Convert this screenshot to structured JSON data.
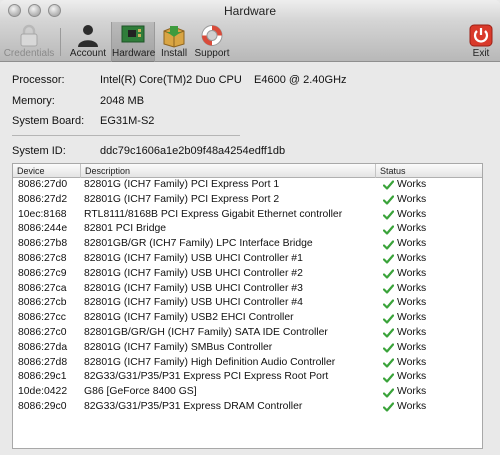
{
  "window": {
    "title": "Hardware"
  },
  "toolbar": {
    "items": [
      {
        "label": "Credentials",
        "icon": "padlock-icon"
      },
      {
        "label": "Account",
        "icon": "user-silhouette-icon"
      },
      {
        "label": "Hardware",
        "icon": "circuit-board-icon"
      },
      {
        "label": "Install",
        "icon": "package-box-icon"
      },
      {
        "label": "Support",
        "icon": "lifebuoy-icon"
      },
      {
        "label": "Exit",
        "icon": "power-icon"
      }
    ]
  },
  "system": {
    "processor_label": "Processor:",
    "processor_value": "Intel(R) Core(TM)2 Duo CPU    E4600 @ 2.40GHz",
    "memory_label": "Memory:",
    "memory_value": "2048 MB",
    "board_label": "System Board:",
    "board_value": "EG31M-S2",
    "id_label": "System ID:",
    "id_value": "ddc79c1606a1e2b09f48a4254edff1db"
  },
  "table": {
    "headers": [
      "Device",
      "Description",
      "Status"
    ],
    "rows": [
      {
        "device": "8086:27d0",
        "description": "82801G (ICH7 Family) PCI Express Port 1",
        "status": "Works"
      },
      {
        "device": "8086:27d2",
        "description": "82801G (ICH7 Family) PCI Express Port 2",
        "status": "Works"
      },
      {
        "device": "10ec:8168",
        "description": "RTL8111/8168B PCI Express Gigabit Ethernet controller",
        "status": "Works"
      },
      {
        "device": "8086:244e",
        "description": "82801 PCI Bridge",
        "status": "Works"
      },
      {
        "device": "8086:27b8",
        "description": "82801GB/GR (ICH7 Family) LPC Interface Bridge",
        "status": "Works"
      },
      {
        "device": "8086:27c8",
        "description": "82801G (ICH7 Family) USB UHCI Controller #1",
        "status": "Works"
      },
      {
        "device": "8086:27c9",
        "description": "82801G (ICH7 Family) USB UHCI Controller #2",
        "status": "Works"
      },
      {
        "device": "8086:27ca",
        "description": "82801G (ICH7 Family) USB UHCI Controller #3",
        "status": "Works"
      },
      {
        "device": "8086:27cb",
        "description": "82801G (ICH7 Family) USB UHCI Controller #4",
        "status": "Works"
      },
      {
        "device": "8086:27cc",
        "description": "82801G (ICH7 Family) USB2 EHCI Controller",
        "status": "Works"
      },
      {
        "device": "8086:27c0",
        "description": "82801GB/GR/GH (ICH7 Family) SATA IDE Controller",
        "status": "Works"
      },
      {
        "device": "8086:27da",
        "description": "82801G (ICH7 Family) SMBus Controller",
        "status": "Works"
      },
      {
        "device": "8086:27d8",
        "description": "82801G (ICH7 Family) High Definition Audio Controller",
        "status": "Works"
      },
      {
        "device": "8086:29c1",
        "description": "82G33/G31/P35/P31 Express PCI Express Root Port",
        "status": "Works"
      },
      {
        "device": "10de:0422",
        "description": "G86 [GeForce 8400 GS]",
        "status": "Works"
      },
      {
        "device": "8086:29c0",
        "description": "82G33/G31/P35/P31 Express DRAM Controller",
        "status": "Works"
      }
    ]
  },
  "colors": {
    "works_check": "#3aa33a",
    "exit_red": "#d93a2b"
  }
}
